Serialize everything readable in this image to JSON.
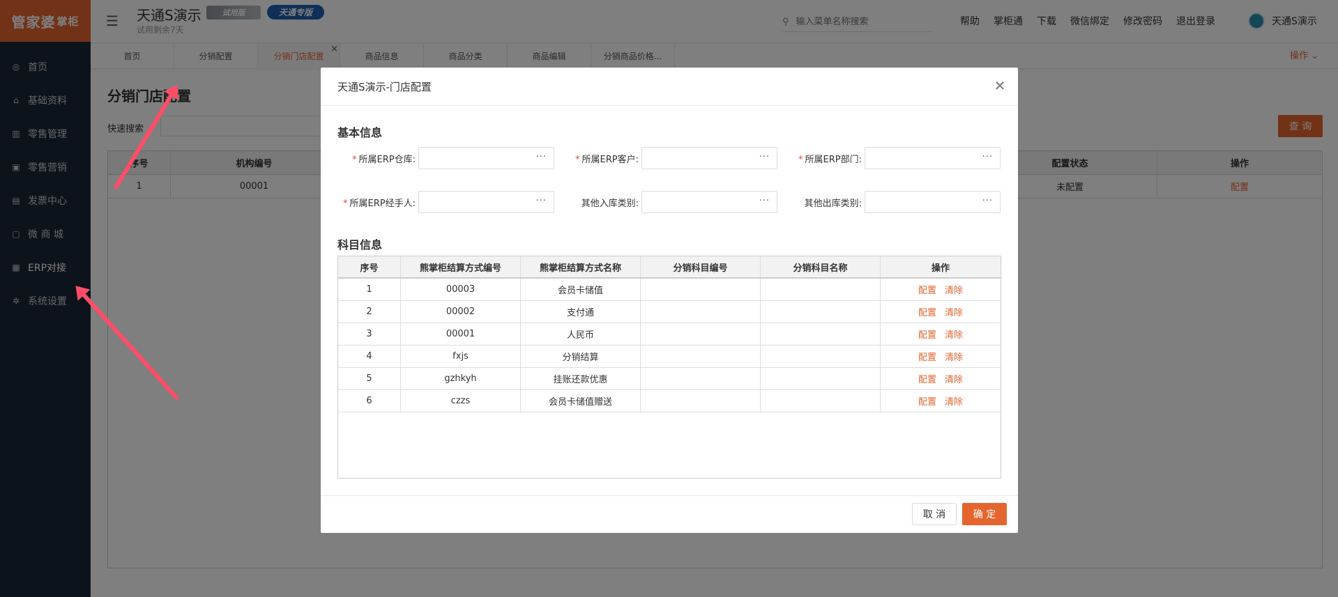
{
  "logo": {
    "text": "管家婆",
    "sub": "掌柜"
  },
  "sidebar": {
    "items": [
      {
        "label": "首页",
        "icon": "globe-icon"
      },
      {
        "label": "基础资料",
        "icon": "home-icon"
      },
      {
        "label": "零售管理",
        "icon": "chart-icon"
      },
      {
        "label": "零售营销",
        "icon": "gift-icon"
      },
      {
        "label": "发票中心",
        "icon": "invoice-icon"
      },
      {
        "label": "微 商 城",
        "icon": "bag-icon"
      },
      {
        "label": "ERP对接",
        "icon": "erp-icon"
      },
      {
        "label": "系统设置",
        "icon": "gear-icon"
      }
    ]
  },
  "header": {
    "app_title": "天通S演示",
    "trial_text": "试用剩余7天",
    "badge_trial": "试用版",
    "badge_edition": "天通专版",
    "search_placeholder": "输入菜单名称搜索",
    "links": [
      "帮助",
      "掌柜通",
      "下载",
      "微信绑定",
      "修改密码",
      "退出登录"
    ],
    "user_name": "天通S演示"
  },
  "tabs": {
    "items": [
      "首页",
      "分销配置",
      "分销门店配置",
      "商品信息",
      "商品分类",
      "商品编辑",
      "分销商品价格..."
    ],
    "close": "×",
    "ops_label": "操作 ⌄"
  },
  "page": {
    "title": "分销门店配置",
    "quick_search_label": "快速搜索",
    "query_button": "查 询",
    "table": {
      "headers": [
        "序号",
        "机构编号",
        "配置状态",
        "操作"
      ],
      "rows": [
        {
          "no": "1",
          "code": "00001",
          "status": "未配置",
          "action": "配置"
        }
      ]
    }
  },
  "modal": {
    "title": "天通S演示-门店配置",
    "basic_title": "基本信息",
    "fields": {
      "erp_warehouse": "所属ERP仓库:",
      "erp_customer": "所属ERP客户:",
      "erp_department": "所属ERP部门:",
      "erp_handler": "所属ERP经手人:",
      "in_type": "其他入库类别:",
      "out_type": "其他出库类别:"
    },
    "required_mark": "*",
    "dots": "···",
    "account_title": "科目信息",
    "table": {
      "headers": [
        "序号",
        "熊掌柜结算方式编号",
        "熊掌柜结算方式名称",
        "分销科目编号",
        "分销科目名称",
        "操作"
      ],
      "rows": [
        {
          "no": "1",
          "code": "00003",
          "name": "会员卡储值",
          "sub_code": "",
          "sub_name": ""
        },
        {
          "no": "2",
          "code": "00002",
          "name": "支付通",
          "sub_code": "",
          "sub_name": ""
        },
        {
          "no": "3",
          "code": "00001",
          "name": "人民币",
          "sub_code": "",
          "sub_name": ""
        },
        {
          "no": "4",
          "code": "fxjs",
          "name": "分销结算",
          "sub_code": "",
          "sub_name": ""
        },
        {
          "no": "5",
          "code": "gzhkyh",
          "name": "挂账还款优惠",
          "sub_code": "",
          "sub_name": ""
        },
        {
          "no": "6",
          "code": "czzs",
          "name": "会员卡储值赠送",
          "sub_code": "",
          "sub_name": ""
        }
      ],
      "action_config": "配置",
      "action_clear": "清除"
    },
    "cancel": "取 消",
    "ok": "确 定"
  },
  "colors": {
    "accent": "#e5652e",
    "sidebar": "#1b2634",
    "arrow": "#ff4d68"
  }
}
